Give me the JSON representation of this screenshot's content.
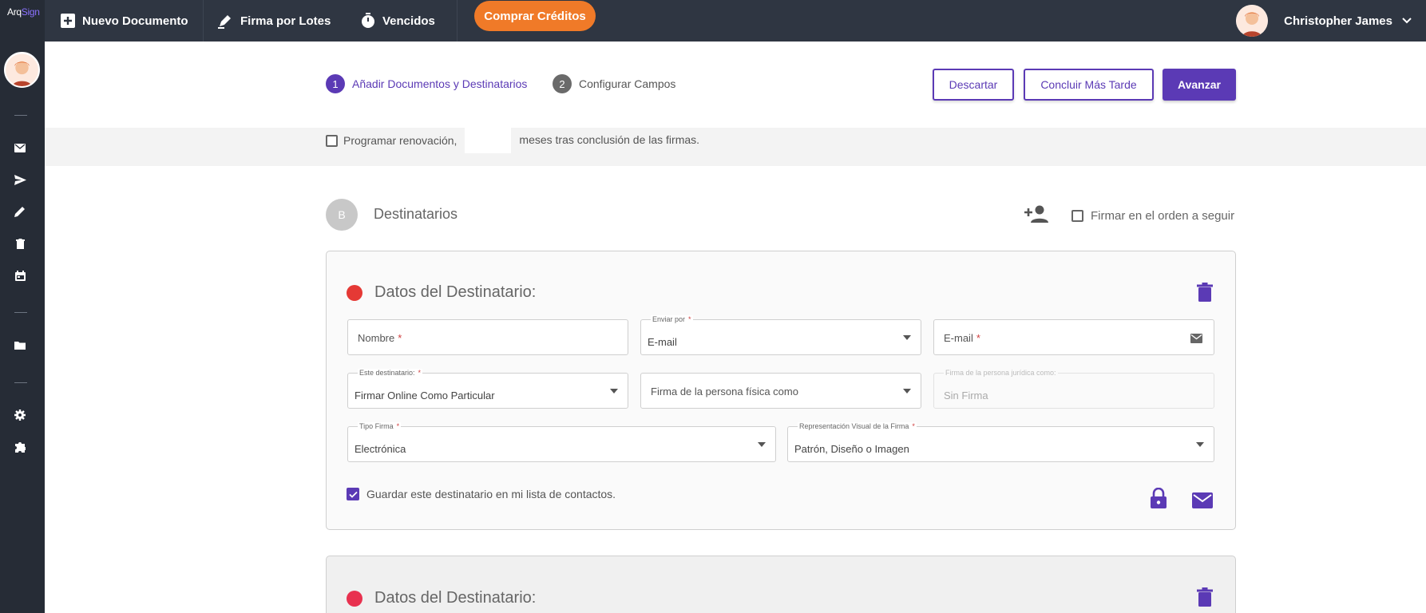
{
  "brand": {
    "logo_prefix": "Arq",
    "logo_suffix": "Sign"
  },
  "topbar": {
    "new_doc": "Nuevo Documento",
    "batch": "Firma por Lotes",
    "expired": "Vencidos",
    "buy_credits": "Comprar Créditos",
    "user_name": "Christopher James"
  },
  "steps": [
    {
      "num": "1",
      "label": "Añadir Documentos y Destinatarios",
      "active": true
    },
    {
      "num": "2",
      "label": "Configurar Campos",
      "active": false
    }
  ],
  "actions": {
    "discard": "Descartar",
    "later": "Concluir Más Tarde",
    "advance": "Avanzar"
  },
  "renew": {
    "before": "Programar renovación,",
    "after": "meses tras conclusión de las firmas."
  },
  "recipients": {
    "badge": "B",
    "title": "Destinatarios",
    "order_label": "Firmar en el orden a seguir"
  },
  "card": {
    "title": "Datos del Destinatario:",
    "name_label": "Nombre",
    "send_by_label": "Enviar por",
    "send_by_value": "E-mail",
    "email_label": "E-mail",
    "this_recipient_label": "Este destinatario:",
    "this_recipient_value": "Firmar Online Como Particular",
    "natural_person_label": "Firma de la persona física como",
    "legal_person_label": "Firma de la persona jurídica como:",
    "legal_person_value": "Sin Firma",
    "sign_type_label": "Tipo Firma",
    "sign_type_value": "Electrónica",
    "visual_label": "Representación Visual de la Firma",
    "visual_value": "Patrón, Diseño o Imagen",
    "save_contact": "Guardar este destinatario en mi lista de contactos.",
    "required_mark": "*"
  },
  "card2": {
    "title": "Datos del Destinatario:"
  },
  "colors": {
    "accent": "#5b3ab5",
    "orange": "#f07a28",
    "red_dot": "#e53935",
    "pink_dot": "#e8314f"
  }
}
